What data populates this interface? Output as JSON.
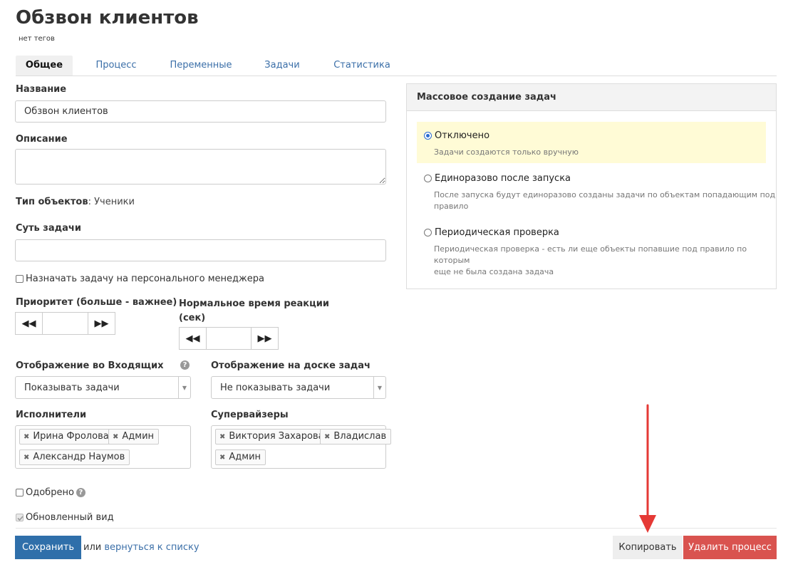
{
  "page": {
    "title": "Обзвон клиентов",
    "tags": "нет тегов"
  },
  "tabs": [
    {
      "label": "Общее",
      "active": true
    },
    {
      "label": "Процесс",
      "active": false
    },
    {
      "label": "Переменные",
      "active": false
    },
    {
      "label": "Задачи",
      "active": false
    },
    {
      "label": "Статистика",
      "active": false
    }
  ],
  "form": {
    "name_label": "Название",
    "name_value": "Обзвон клиентов",
    "description_label": "Описание",
    "description_value": "",
    "object_type_label": "Тип объектов",
    "object_type_value": ": Ученики",
    "task_essence_label": "Суть задачи",
    "task_essence_value": "",
    "assign_manager_label": "Назначать задачу на персонального менеджера",
    "assign_manager_checked": false,
    "priority_label": "Приоритет (больше - важнее)",
    "priority_value": "",
    "reaction_time_label_line1": "Нормальное время реакции",
    "reaction_time_label_line2": "(сек)",
    "reaction_time_value": "",
    "inbox_display_label": "Отображение во Входящих",
    "inbox_display_value": "Показывать задачи",
    "board_display_label": "Отображение на доске задач",
    "board_display_value": "Не показывать задачи",
    "executors_label": "Исполнители",
    "executors": [
      "Ирина Фролова",
      "Админ",
      "Александр Наумов"
    ],
    "supervisors_label": "Супервайзеры",
    "supervisors": [
      "Виктория Захарова",
      "Владислав",
      "Админ"
    ],
    "approved_label": "Одобрено",
    "approved_checked": false,
    "updated_view_label": "Обновленный вид",
    "updated_view_checked": true
  },
  "mass_creation": {
    "title": "Массовое создание задач",
    "options": [
      {
        "label": "Отключено",
        "desc": "Задачи создаются только вручную",
        "selected": true
      },
      {
        "label": "Единоразово после запуска",
        "desc_line1": "После запуска будут единоразово созданы задачи по объектам попадающим под",
        "desc_line2": "правило",
        "selected": false
      },
      {
        "label": "Периодическая проверка",
        "desc_line1": "Периодическая проверка - есть ли еще объекты попавшие под правило по которым",
        "desc_line2": "еще не была создана задача",
        "selected": false
      }
    ]
  },
  "actions": {
    "save": "Сохранить",
    "or": "или",
    "back_link": "вернуться к списку",
    "copy": "Копировать",
    "delete": "Удалить процесс"
  },
  "colors": {
    "primary": "#2f6faa",
    "danger": "#d9534f",
    "highlight": "#fffbd6",
    "annotation_arrow": "#e53935"
  },
  "icons": {
    "help": "question-circle-icon",
    "chip_remove": "times-icon",
    "stepper_prev": "backward-icon",
    "stepper_next": "forward-icon"
  }
}
